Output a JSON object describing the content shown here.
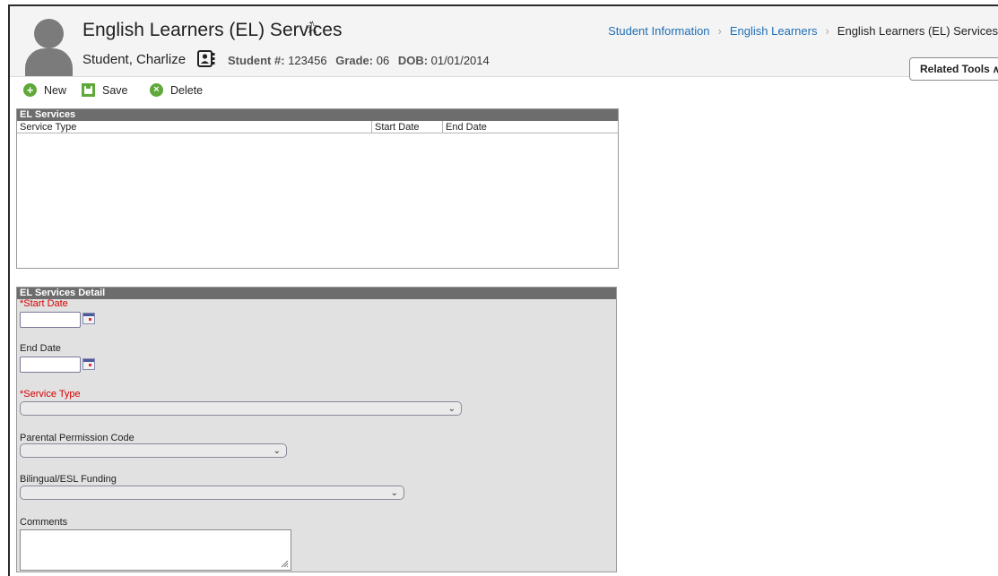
{
  "header": {
    "title": "English Learners (EL) Services",
    "student_name": "Student, Charlize",
    "student_number_label": "Student #:",
    "student_number": "123456",
    "grade_label": "Grade:",
    "grade": "06",
    "dob_label": "DOB:",
    "dob": "01/01/2014",
    "related_tools_label": "Related Tools",
    "breadcrumb": [
      "Student Information",
      "English Learners",
      "English Learners (EL) Services"
    ]
  },
  "toolbar": {
    "new_label": "New",
    "save_label": "Save",
    "delete_label": "Delete"
  },
  "services_grid": {
    "title": "EL Services",
    "columns": [
      "Service Type",
      "Start Date",
      "End Date"
    ],
    "rows": []
  },
  "detail": {
    "title": "EL Services Detail",
    "start_date_label": "*Start Date",
    "start_date_value": "",
    "end_date_label": "End Date",
    "end_date_value": "",
    "service_type_label": "*Service Type",
    "service_type_value": "",
    "parental_permission_label": "Parental Permission Code",
    "parental_permission_value": "",
    "funding_label": "Bilingual/ESL Funding",
    "funding_value": "",
    "comments_label": "Comments",
    "comments_value": ""
  },
  "icons": {
    "favorite": "star-outline-icon",
    "contact": "contact-card-icon",
    "new": "plus-circle-icon",
    "save": "save-disk-icon",
    "delete": "x-circle-icon",
    "calendar": "calendar-icon",
    "dropdown": "chevron-down-icon"
  },
  "colors": {
    "link": "#1f6fb5",
    "required": "#d60000",
    "toolbar_icon": "#5fa83a",
    "panel_header": "#6d6d6d",
    "panel_background": "#e1e1e1"
  }
}
